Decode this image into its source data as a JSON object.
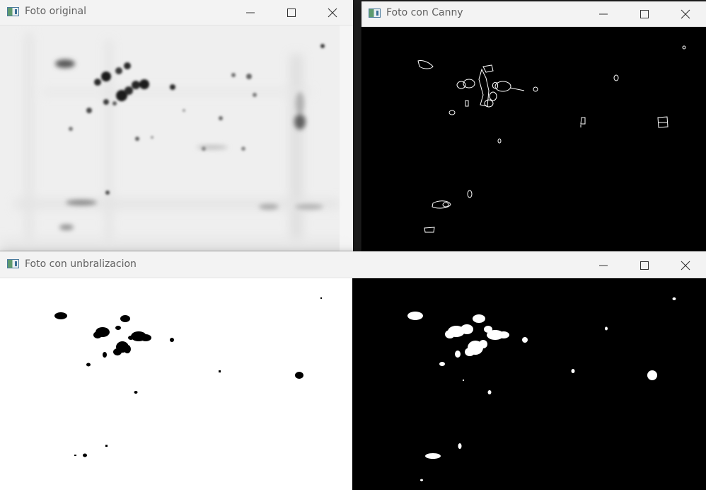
{
  "windows": {
    "original": {
      "title": "Foto original"
    },
    "canny": {
      "title": "Foto con Canny"
    },
    "threshold": {
      "title": "Foto con unbralizacion"
    }
  },
  "icons": {
    "app": "opencv-window-icon",
    "minimize": "minimize-icon",
    "maximize": "maximize-icon",
    "close": "close-icon"
  },
  "colors": {
    "titlebar_bg": "#f3f3f3",
    "title_text": "#616161",
    "canny_bg": "#000000",
    "edge": "#ffffff",
    "threshold_left_bg": "#ffffff",
    "threshold_right_bg": "#000000"
  }
}
